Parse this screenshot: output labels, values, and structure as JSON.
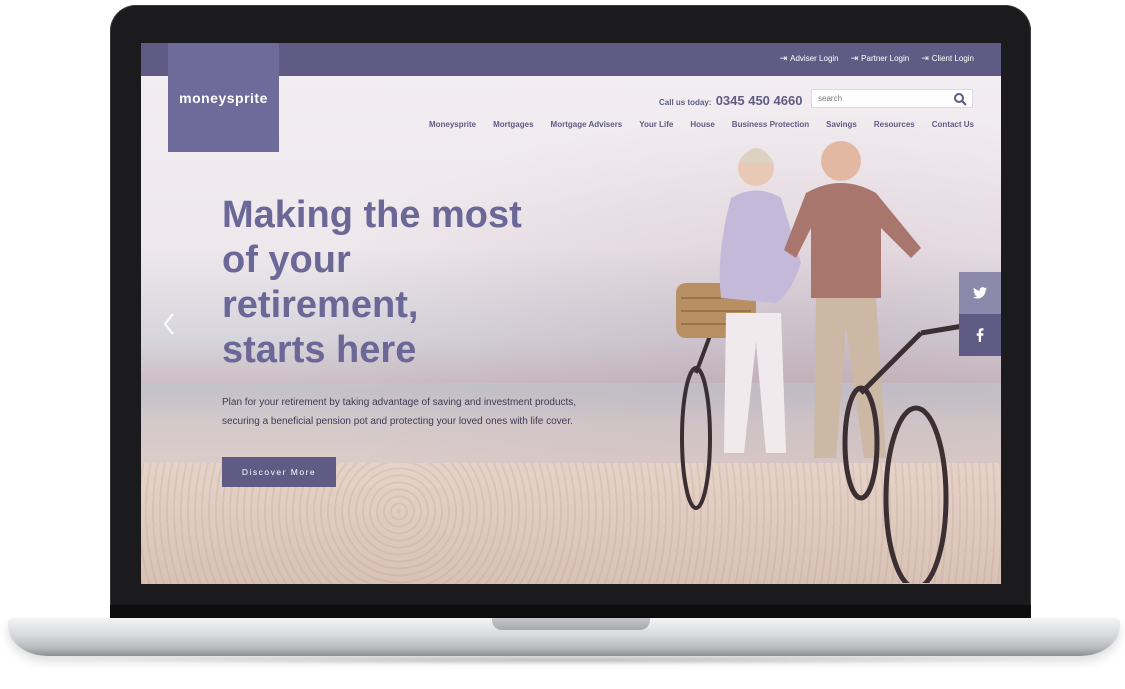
{
  "topbar": {
    "links": [
      {
        "label": "Adviser Login",
        "icon": "login-icon"
      },
      {
        "label": "Partner Login",
        "icon": "login-icon"
      },
      {
        "label": "Client Login",
        "icon": "login-icon"
      }
    ]
  },
  "logo": {
    "text": "moneysprite"
  },
  "header": {
    "call_label": "Call us today:",
    "phone": "0345 450 4660",
    "search_placeholder": "search"
  },
  "nav": {
    "items": [
      "Moneysprite",
      "Mortgages",
      "Mortgage Advisers",
      "Your Life",
      "House",
      "Business Protection",
      "Savings",
      "Resources",
      "Contact Us"
    ]
  },
  "hero": {
    "title_lines": [
      "Making the most",
      "of your",
      "retirement,",
      "starts here"
    ],
    "text_lines": [
      "Plan for your retirement by taking advantage of saving and investment products,",
      "securing a beneficial pension pot and protecting your loved ones with life cover."
    ],
    "cta_label": "Discover More"
  },
  "social": {
    "icons": [
      "twitter-icon",
      "facebook-icon"
    ]
  },
  "colors": {
    "brand": "#5f5b85",
    "logo_bg": "#6e6a99",
    "title": "#6b6797"
  }
}
